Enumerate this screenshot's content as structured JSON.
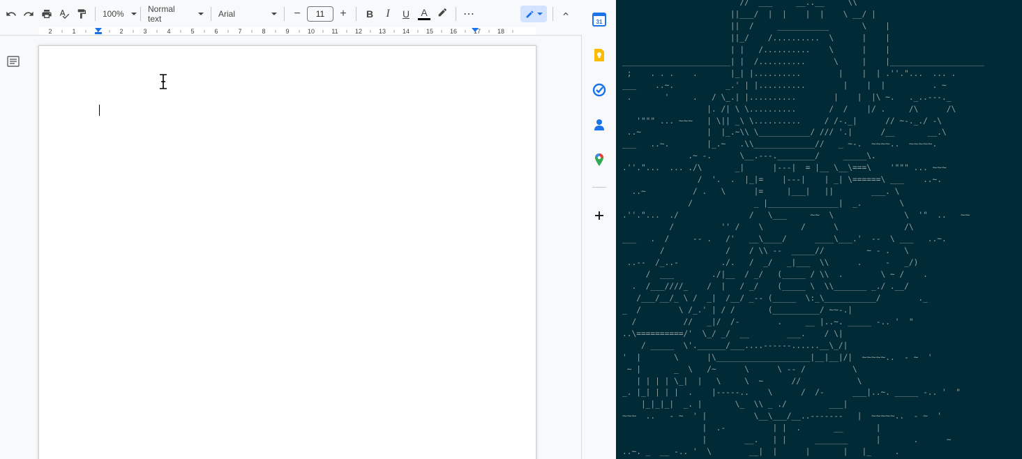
{
  "toolbar": {
    "zoom": "100%",
    "style": "Normal text",
    "font": "Arial",
    "font_size": "11",
    "font_size_minus": "−",
    "font_size_plus": "+",
    "bold": "B",
    "italic": "I",
    "underline": "U",
    "text_color_label": "A",
    "more": "⋯"
  },
  "ruler": {
    "ticks": [
      "2",
      "1",
      "1",
      "2",
      "3",
      "4",
      "5",
      "6",
      "7",
      "8",
      "9",
      "10",
      "11",
      "12",
      "13",
      "14",
      "15",
      "16",
      "17",
      "18"
    ]
  },
  "side_panel": {
    "calendar_day": "31",
    "apps": [
      "calendar-icon",
      "keep-icon",
      "tasks-icon",
      "contacts-icon",
      "maps-icon",
      "add-icon"
    ]
  },
  "colors": {
    "terminal_bg": "#002b36",
    "terminal_fg": "#93a1a1",
    "edit_mode_bg": "#d3e3fd",
    "accent": "#1a73e8"
  },
  "terminal": {
    "ascii_art": "                         //  ___     __..__     \\\\\n                       ||___/  |  |    |  |    \\ __/ |\n                       ||  /     ___________       \\    |\n                       ||_/    /..........  \\      |    |\n                       | |   /..........    \\      |    |\n_______________________| |  /..........      \\     |    |____________________\n ;    . . .    .       |_| |..........        |    |  | .''.\"...  ... .\n___    ..~.           _.' | |..........        |    |  |          . ~\n .       '     .   / \\_.| |..........        |    |  |\\ ~.   ._..---._\n                  |. /| \\ \\..........       /  /    |/ .     /\\      /\\\n   '\"\"\" ... ~~~   | \\|| _\\ \\..........     / /-._|      // ~-._./ -\\\n ..~              |  |_.~\\\\ \\___________/ /// '.|      /__       __.\\\n___   ..~.        |_.~   .\\\\_____________//   _ ~-.  ~~~~..  ~~~~~.\n              .~ -.      \\__.---.________/     _____\\.\n.''.\"...  ... ./\\       _|      |---|  = |__ \\__\\===\\    '\"\"\" ... ~~~\n                /  '.  .  |_|=    |---|    | _| \\======\\ ___    ..~.\n  ..~          / .   \\      |=     |___|   ||        ___. \\\n              /             _ |_______________|  _.        \\\n.''.\"...  ./               /   \\___     ~~  \\               \\  '\"  ..   ~~\n          /          '' /    \\        /      \\              /\\\n___   .  /     -- .   /'   __\\____/      ____\\___.'  --  \\ ___   ..~.\n        /             /    / \\\\ --  _____//         ~ - .   \\\n ..--  /_..-         ./.   /  _/   _|___  \\\\      .     -   _/)\n     /  ___        ./|__  / _/   (_____ / \\\\  .        \\ ~ /    .\n  .  /___////_    /  |   / _/    (_____ \\  \\\\_______ _./ .__/\n   /___/__/_ \\ /  _|  /__/ _-- (_____  \\:_\\___________/        ._\n_  /        \\ /_.' | / /       (__________/ ~~-.|\n  /          //   _|/  /-        .     __ |..~. _____ -.. '  \"\n..\\==========/'  \\_/ _/  __        ___.    / \\|\n    / _____  \\'.______/___....------......__\\_/|\n'  |       \\      |\\____________________|__|__|/|  ~~~~~..  - ~  '\n ~ |       _  \\   /~      \\      \\ -- /          \\\n   | | | | \\_|  |   \\     \\  ~      //            \\\n_. |_| | | |  .    |-----..    \\      /  /-      ___|..~. _____ -.. '  \"\n    |_|_|_|  _. |       \\_  \\\\ _ ./         ___|\n~~~  ..   - ~  ' |          \\__\\___/__..-------   |  ~~~~~..  - ~  '\n                 |  .-          | |  .       __       |\n                 |        __.   | |      _______      |       .      ~\n..~. _  __ -.. '  \\        __|  |      |       |   |_     .\n                  /                              |           |"
  }
}
